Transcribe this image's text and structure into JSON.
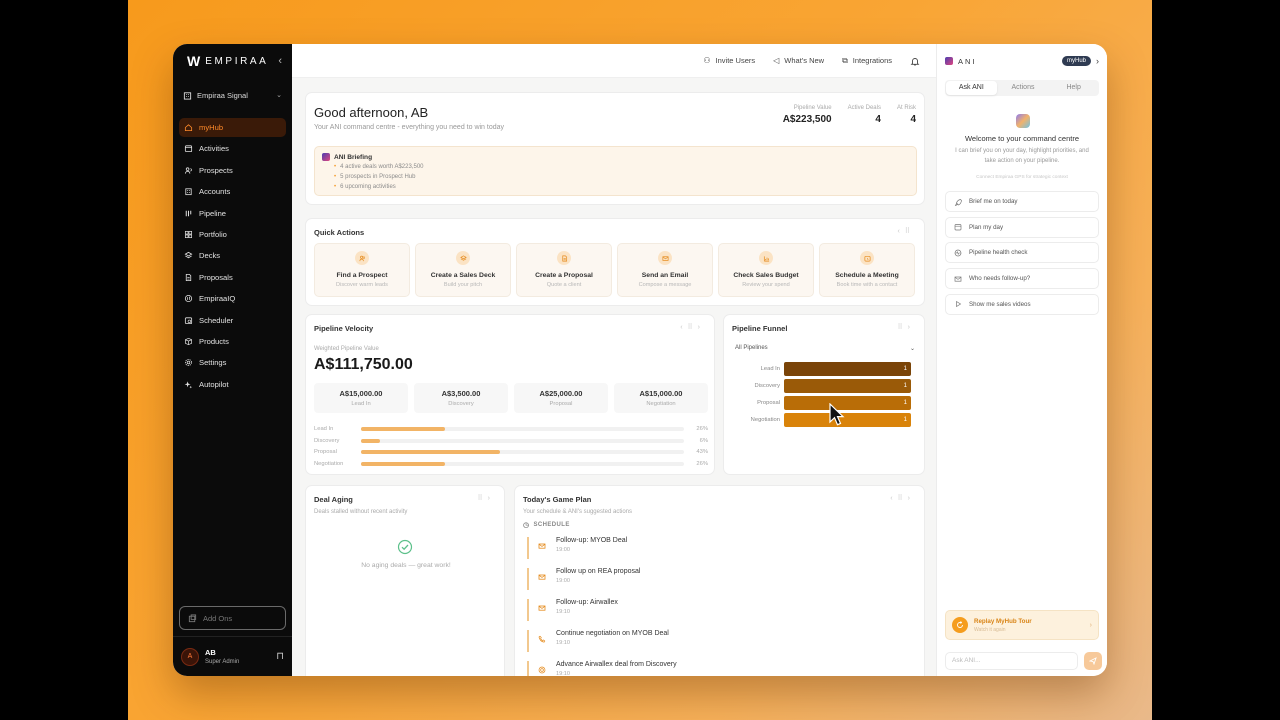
{
  "colors": {
    "accent": "#f59d1e",
    "sidebar_bg": "#0b0b0b",
    "active_nav": "#ff8a2a"
  },
  "sidebar": {
    "logo_text": "EMPIRAA",
    "workspace": "Empiraa Signal",
    "items": [
      {
        "label": "myHub",
        "icon": "home-icon",
        "active": true
      },
      {
        "label": "Activities",
        "icon": "calendar-icon"
      },
      {
        "label": "Prospects",
        "icon": "users-icon"
      },
      {
        "label": "Accounts",
        "icon": "building-icon"
      },
      {
        "label": "Pipeline",
        "icon": "pipeline-icon"
      },
      {
        "label": "Portfolio",
        "icon": "grid-icon"
      },
      {
        "label": "Decks",
        "icon": "layers-icon"
      },
      {
        "label": "Proposals",
        "icon": "file-icon"
      },
      {
        "label": "EmpiraaIQ",
        "icon": "iq-icon"
      },
      {
        "label": "Scheduler",
        "icon": "clock-calendar-icon"
      },
      {
        "label": "Products",
        "icon": "box-icon"
      },
      {
        "label": "Settings",
        "icon": "gear-icon"
      },
      {
        "label": "Autopilot",
        "icon": "sparkle-icon"
      }
    ],
    "addons_label": "Add Ons",
    "user": {
      "initial": "A",
      "name": "AB",
      "role": "Super Admin"
    }
  },
  "topbar": {
    "invite": "Invite Users",
    "whats_new": "What's New",
    "integrations": "Integrations"
  },
  "greeting": {
    "title": "Good afternoon, AB",
    "subtitle": "Your ANI command centre - everything you need to win today",
    "kpis": [
      {
        "label": "Pipeline Value",
        "value": "A$223,500"
      },
      {
        "label": "Active Deals",
        "value": "4"
      },
      {
        "label": "At Risk",
        "value": "4"
      }
    ],
    "briefing_title": "ANI Briefing",
    "briefing_items": [
      "4 active deals worth A$223,500",
      "5 prospects in Prospect Hub",
      "6 upcoming activities"
    ]
  },
  "quick_actions": {
    "title": "Quick Actions",
    "items": [
      {
        "title": "Find a Prospect",
        "desc": "Discover warm leads"
      },
      {
        "title": "Create a Sales Deck",
        "desc": "Build your pitch"
      },
      {
        "title": "Create a Proposal",
        "desc": "Quote a client"
      },
      {
        "title": "Send an Email",
        "desc": "Compose a message"
      },
      {
        "title": "Check Sales Budget",
        "desc": "Review your spend"
      },
      {
        "title": "Schedule a Meeting",
        "desc": "Book time with a contact"
      }
    ]
  },
  "velocity": {
    "title": "Pipeline Velocity",
    "weighted_label": "Weighted Pipeline Value",
    "weighted_value": "A$111,750.00",
    "stages": [
      {
        "value": "A$15,000.00",
        "label": "Lead In"
      },
      {
        "value": "A$3,500.00",
        "label": "Discovery"
      },
      {
        "value": "A$25,000.00",
        "label": "Proposal"
      },
      {
        "value": "A$15,000.00",
        "label": "Negotiation"
      }
    ],
    "bars": [
      {
        "label": "Lead In",
        "pct": 26,
        "pct_label": "26%"
      },
      {
        "label": "Discovery",
        "pct": 6,
        "pct_label": "6%"
      },
      {
        "label": "Proposal",
        "pct": 43,
        "pct_label": "43%"
      },
      {
        "label": "Negotiation",
        "pct": 26,
        "pct_label": "26%"
      }
    ]
  },
  "funnel": {
    "title": "Pipeline Funnel",
    "filter": "All Pipelines",
    "rows": [
      {
        "label": "Lead In",
        "count": "1",
        "color": "#7a4408"
      },
      {
        "label": "Discovery",
        "count": "1",
        "color": "#9a5a08"
      },
      {
        "label": "Proposal",
        "count": "1",
        "color": "#b96d07"
      },
      {
        "label": "Negotiation",
        "count": "1",
        "color": "#d9830a"
      }
    ]
  },
  "aging": {
    "title": "Deal Aging",
    "subtitle": "Deals stalled without recent activity",
    "empty": "No aging deals — great work!"
  },
  "game_plan": {
    "title": "Today's Game Plan",
    "subtitle": "Your schedule & ANI's suggested actions",
    "schedule_label": "SCHEDULE",
    "events": [
      {
        "title": "Follow-up: MYOB Deal",
        "time": "19:00",
        "icon": "mail-icon"
      },
      {
        "title": "Follow up on REA proposal",
        "time": "19:00",
        "icon": "mail-icon"
      },
      {
        "title": "Follow-up: Airwallex",
        "time": "19:10",
        "icon": "mail-icon"
      },
      {
        "title": "Continue negotiation on MYOB Deal",
        "time": "19:10",
        "icon": "phone-icon"
      },
      {
        "title": "Advance Airwallex deal from Discovery",
        "time": "19:10",
        "icon": "target-icon"
      }
    ]
  },
  "ani_panel": {
    "name": "ANI",
    "hub_pill": "myHub",
    "tabs": [
      "Ask ANI",
      "Actions",
      "Help"
    ],
    "welcome_title": "Welcome to your command centre",
    "welcome_desc": "I can brief you on your day, highlight priorities, and take action on your pipeline.",
    "welcome_note": "Connect Empiraa GPS for strategic context",
    "suggestions": [
      {
        "label": "Brief me on today",
        "icon": "rocket-icon"
      },
      {
        "label": "Plan my day",
        "icon": "calendar-icon"
      },
      {
        "label": "Pipeline health check",
        "icon": "pulse-icon"
      },
      {
        "label": "Who needs follow-up?",
        "icon": "mail-icon"
      },
      {
        "label": "Show me sales videos",
        "icon": "play-icon"
      }
    ],
    "replay_title": "Replay MyHub Tour",
    "replay_sub": "Watch it again",
    "ask_placeholder": "Ask ANI..."
  }
}
